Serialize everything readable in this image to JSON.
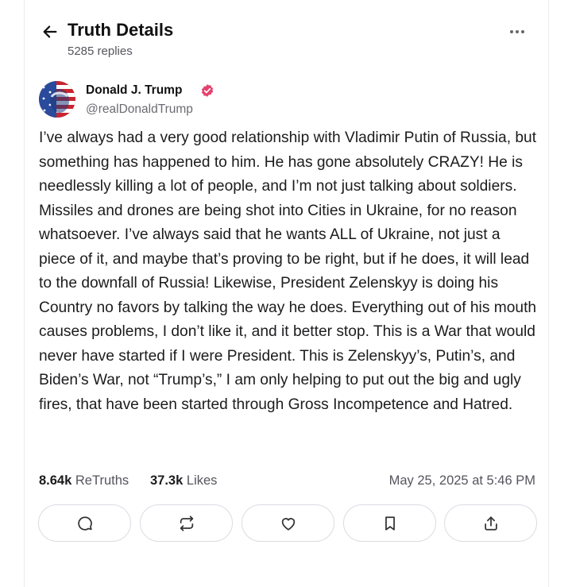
{
  "header": {
    "title": "Truth Details",
    "replies": "5285 replies"
  },
  "post": {
    "author_name": "Donald J. Trump",
    "author_handle": "@realDonaldTrump",
    "verified_color": "#e4416f",
    "text": "I’ve always had a very good relationship with Vladimir Putin of Russia, but something has happened to him. He has gone absolutely CRAZY! He is needlessly killing a lot of people, and I’m not just talking about soldiers. Missiles and drones are being shot into Cities in Ukraine, for no reason whatsoever. I’ve always said that he wants ALL of Ukraine, not just a piece of it, and maybe that’s proving to be right, but if he does, it will lead to the downfall of Russia! Likewise, President Zelenskyy is doing his Country no favors by talking the way he does. Everything out of his mouth causes problems, I don’t like it, and it better stop. This is a War that would never have started if I were President. This is Zelenskyy’s, Putin’s, and Biden’s War, not “Trump’s,” I am only helping to put out the big and ugly fires, that have been started through Gross Incompetence and Hatred.",
    "retruths_count": "8.64k",
    "retruths_label": "ReTruths",
    "likes_count": "37.3k",
    "likes_label": "Likes",
    "timestamp": "May 25, 2025 at 5:46 PM"
  },
  "actions": [
    {
      "icon": "reply-icon"
    },
    {
      "icon": "retruth-icon"
    },
    {
      "icon": "like-icon"
    },
    {
      "icon": "bookmark-icon"
    },
    {
      "icon": "share-icon"
    }
  ]
}
